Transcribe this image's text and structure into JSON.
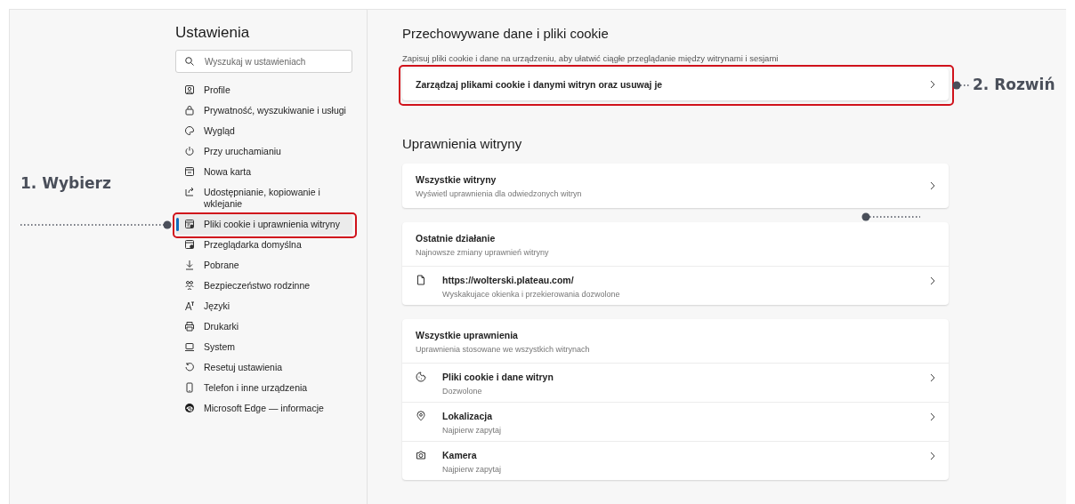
{
  "sidebar": {
    "title": "Ustawienia",
    "search": {
      "placeholder": "Wyszukaj w ustawieniach"
    },
    "items": [
      {
        "label": "Profile",
        "selected": false
      },
      {
        "label": "Prywatność, wyszukiwanie i usługi",
        "selected": false
      },
      {
        "label": "Wygląd",
        "selected": false
      },
      {
        "label": "Przy uruchamianiu",
        "selected": false
      },
      {
        "label": "Nowa karta",
        "selected": false
      },
      {
        "label": "Udostępnianie, kopiowanie i wklejanie",
        "selected": false
      },
      {
        "label": "Pliki cookie i uprawnienia witryny",
        "selected": true
      },
      {
        "label": "Przeglądarka domyślna",
        "selected": false
      },
      {
        "label": "Pobrane",
        "selected": false
      },
      {
        "label": "Bezpieczeństwo rodzinne",
        "selected": false
      },
      {
        "label": "Języki",
        "selected": false
      },
      {
        "label": "Drukarki",
        "selected": false
      },
      {
        "label": "System",
        "selected": false
      },
      {
        "label": "Resetuj ustawienia",
        "selected": false
      },
      {
        "label": "Telefon i inne urządzenia",
        "selected": false
      },
      {
        "label": "Microsoft Edge — informacje",
        "selected": false
      }
    ]
  },
  "storage": {
    "title": "Przechowywane dane i pliki cookie",
    "description": "Zapisuj pliki cookie i dane na urządzeniu, aby ułatwić ciągłe przeglądanie między witrynami i sesjami",
    "manage": "Zarządzaj plikami cookie i danymi witryn oraz usuwaj je"
  },
  "permissions": {
    "title": "Uprawnienia witryny",
    "all_sites": {
      "title": "Wszystkie witryny",
      "subtitle": "Wyświetl uprawnienia dla odwiedzonych witryn"
    },
    "recent": {
      "title": "Ostatnie działanie",
      "subtitle": "Najnowsze zmiany uprawnień witryny",
      "items": [
        {
          "title": "https://wolterski.plateau.com/",
          "subtitle": "Wyskakujace okienka i przekierowania dozwolone"
        }
      ]
    },
    "all_permissions": {
      "title": "Wszystkie uprawnienia",
      "subtitle": "Uprawnienia stosowane we wszystkich witrynach",
      "items": [
        {
          "title": "Pliki cookie i dane witryn",
          "subtitle": "Dozwolone"
        },
        {
          "title": "Lokalizacja",
          "subtitle": "Najpierw zapytaj"
        },
        {
          "title": "Kamera",
          "subtitle": "Najpierw zapytaj"
        }
      ]
    }
  },
  "annotations": [
    {
      "label": "1. Wybierz"
    },
    {
      "label": "2. Rozwiń"
    }
  ]
}
